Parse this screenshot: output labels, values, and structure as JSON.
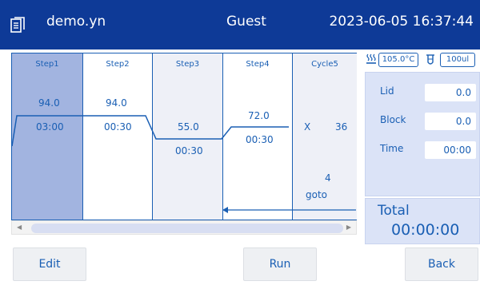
{
  "header": {
    "app_title": "demo.yn",
    "user": "Guest",
    "datetime": "2023-06-05 16:37:44"
  },
  "columns": [
    {
      "header": "Step1",
      "temp": "94.0",
      "time": "03:00"
    },
    {
      "header": "Step2",
      "temp": "94.0",
      "time": "00:30"
    },
    {
      "header": "Step3",
      "temp": "55.0",
      "time": "00:30"
    },
    {
      "header": "Step4",
      "temp": "72.0",
      "time": "00:30"
    },
    {
      "header": "Cycle5",
      "x_label": "X",
      "count": "36",
      "step_ref": "4",
      "goto_label": "goto"
    }
  ],
  "status": {
    "lid_temp": "105.0°C",
    "volume": "100ul"
  },
  "panel": {
    "lid_label": "Lid",
    "lid_value": "0.0",
    "block_label": "Block",
    "block_value": "0.0",
    "time_label": "Time",
    "time_value": "00:00"
  },
  "total": {
    "label": "Total",
    "value": "00:00:00"
  },
  "buttons": {
    "edit": "Edit",
    "run": "Run",
    "back": "Back"
  },
  "icons": {
    "app": "document-icon",
    "lid": "heated-lid-icon",
    "tube": "tube-icon"
  },
  "colors": {
    "header_bg": "#0e3a97",
    "accent": "#1a5fb4",
    "selected_step": "#a2b4e0",
    "panel_bg": "#dbe3f7"
  }
}
